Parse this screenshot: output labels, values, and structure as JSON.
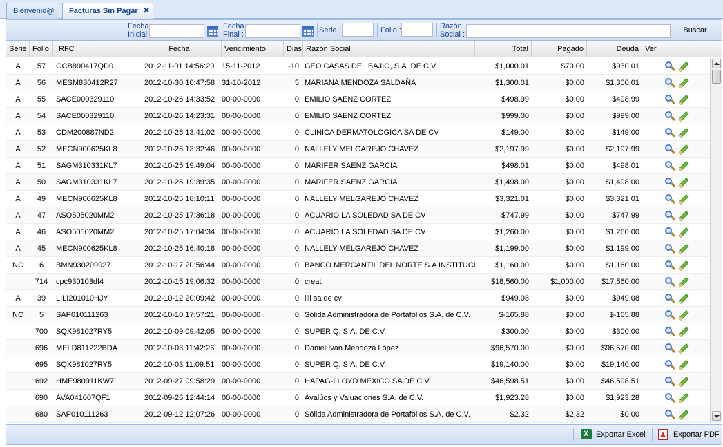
{
  "tabs": [
    {
      "label": "Bienvenid@"
    },
    {
      "label": "Facturas Sin Pagar"
    }
  ],
  "toolbar": {
    "fecha_inicial_label_1": "Fecha",
    "fecha_inicial_label_2": "Inicial :",
    "fecha_final_label_1": "Fecha",
    "fecha_final_label_2": "Final :",
    "serie_label": "Serie :",
    "folio_label": "Folio :",
    "razon_label_1": "Razón",
    "razon_label_2": "Social :",
    "fecha_inicial_value": "",
    "fecha_final_value": "",
    "serie_value": "",
    "folio_value": "",
    "razon_value": "",
    "buscar_label": "Buscar"
  },
  "columns": {
    "serie": "Serie",
    "folio": "Folio",
    "rfc": "RFC",
    "fecha": "Fecha",
    "vencimiento": "Vencimiento",
    "dias": "Dias",
    "razon": "Razón Social",
    "total": "Total",
    "pagado": "Pagado",
    "deuda": "Deuda",
    "ver": "Ver"
  },
  "rows": [
    {
      "serie": "A",
      "folio": "57",
      "rfc": "GCB890417QD0",
      "fecha": "2012-11-01 14:56:29",
      "venc": "15-11-2012",
      "dias": "-10",
      "razon": "GEO CASAS DEL BAJIO, S.A. DE C.V.",
      "total": "$1,000.01",
      "pagado": "$70.00",
      "deuda": "$930.01"
    },
    {
      "serie": "A",
      "folio": "56",
      "rfc": "MESM830412R27",
      "fecha": "2012-10-30 10:47:58",
      "venc": "31-10-2012",
      "dias": "5",
      "razon": "MARIANA MENDOZA SALDAÑA",
      "total": "$1,300.01",
      "pagado": "$0.00",
      "deuda": "$1,300.01"
    },
    {
      "serie": "A",
      "folio": "55",
      "rfc": "SACE000329110",
      "fecha": "2012-10-26 14:33:52",
      "venc": "00-00-0000",
      "dias": "0",
      "razon": "EMILIO SAENZ CORTEZ",
      "total": "$498.99",
      "pagado": "$0.00",
      "deuda": "$498.99"
    },
    {
      "serie": "A",
      "folio": "54",
      "rfc": "SACE000329110",
      "fecha": "2012-10-26 14:23:31",
      "venc": "00-00-0000",
      "dias": "0",
      "razon": "EMILIO SAENZ CORTEZ",
      "total": "$999.00",
      "pagado": "$0.00",
      "deuda": "$999.00"
    },
    {
      "serie": "A",
      "folio": "53",
      "rfc": "CDM200887ND2",
      "fecha": "2012-10-26 13:41:02",
      "venc": "00-00-0000",
      "dias": "0",
      "razon": "CLINICA DERMATOLOGICA SA DE CV",
      "total": "$149.00",
      "pagado": "$0.00",
      "deuda": "$149.00"
    },
    {
      "serie": "A",
      "folio": "52",
      "rfc": "MECN900625KL8",
      "fecha": "2012-10-26 13:32:46",
      "venc": "00-00-0000",
      "dias": "0",
      "razon": "NALLELY MELGAREJO CHAVEZ",
      "total": "$2,197.99",
      "pagado": "$0.00",
      "deuda": "$2,197.99"
    },
    {
      "serie": "A",
      "folio": "51",
      "rfc": "SAGM310331KL7",
      "fecha": "2012-10-25 19:49:04",
      "venc": "00-00-0000",
      "dias": "0",
      "razon": "MARIFER SAENZ GARCIA",
      "total": "$498.01",
      "pagado": "$0.00",
      "deuda": "$498.01"
    },
    {
      "serie": "A",
      "folio": "50",
      "rfc": "SAGM310331KL7",
      "fecha": "2012-10-25 19:39:35",
      "venc": "00-00-0000",
      "dias": "0",
      "razon": "MARIFER SAENZ GARCIA",
      "total": "$1,498.00",
      "pagado": "$0.00",
      "deuda": "$1,498.00"
    },
    {
      "serie": "A",
      "folio": "49",
      "rfc": "MECN900625KL8",
      "fecha": "2012-10-25 18:10:11",
      "venc": "00-00-0000",
      "dias": "0",
      "razon": "NALLELY MELGAREJO CHAVEZ",
      "total": "$3,321.01",
      "pagado": "$0.00",
      "deuda": "$3,321.01"
    },
    {
      "serie": "A",
      "folio": "47",
      "rfc": "ASO505020MM2",
      "fecha": "2012-10-25 17:36:18",
      "venc": "00-00-0000",
      "dias": "0",
      "razon": "ACUARIO LA SOLEDAD SA DE CV",
      "total": "$747.99",
      "pagado": "$0.00",
      "deuda": "$747.99"
    },
    {
      "serie": "A",
      "folio": "46",
      "rfc": "ASO505020MM2",
      "fecha": "2012-10-25 17:04:34",
      "venc": "00-00-0000",
      "dias": "0",
      "razon": "ACUARIO LA SOLEDAD SA DE CV",
      "total": "$1,260.00",
      "pagado": "$0.00",
      "deuda": "$1,260.00"
    },
    {
      "serie": "A",
      "folio": "45",
      "rfc": "MECN900625KL8",
      "fecha": "2012-10-25 16:40:18",
      "venc": "00-00-0000",
      "dias": "0",
      "razon": "NALLELY MELGAREJO CHAVEZ",
      "total": "$1,199.00",
      "pagado": "$0.00",
      "deuda": "$1,199.00"
    },
    {
      "serie": "NC",
      "folio": "6",
      "rfc": "BMN930209927",
      "fecha": "2012-10-17 20:56:44",
      "venc": "00-00-0000",
      "dias": "0",
      "razon": "BANCO MERCANTIL DEL NORTE S.A INSTITUCION D",
      "total": "$1,160.00",
      "pagado": "$0.00",
      "deuda": "$1,160.00"
    },
    {
      "serie": "",
      "folio": "714",
      "rfc": "cpc930103df4",
      "fecha": "2012-10-15 19:06:32",
      "venc": "00-00-0000",
      "dias": "0",
      "razon": "creat",
      "total": "$18,560.00",
      "pagado": "$1,000.00",
      "deuda": "$17,560.00"
    },
    {
      "serie": "A",
      "folio": "39",
      "rfc": "LILI201010HJY",
      "fecha": "2012-10-12 20:09:42",
      "venc": "00-00-0000",
      "dias": "0",
      "razon": "lili sa de cv",
      "total": "$949.08",
      "pagado": "$0.00",
      "deuda": "$949.08"
    },
    {
      "serie": "NC",
      "folio": "5",
      "rfc": "SAP010111263",
      "fecha": "2012-10-10 17:57:21",
      "venc": "00-00-0000",
      "dias": "0",
      "razon": "Sólida Administradora de Portafolios S.A. de C.V.",
      "total": "$-165.88",
      "pagado": "$0.00",
      "deuda": "$-165.88"
    },
    {
      "serie": "",
      "folio": "700",
      "rfc": "SQX981027RY5",
      "fecha": "2012-10-09 09:42:05",
      "venc": "00-00-0000",
      "dias": "0",
      "razon": "SUPER Q, S.A. DE C.V.",
      "total": "$300.00",
      "pagado": "$0.00",
      "deuda": "$300.00"
    },
    {
      "serie": "",
      "folio": "696",
      "rfc": "MELD811222BDA",
      "fecha": "2012-10-03 11:42:26",
      "venc": "00-00-0000",
      "dias": "0",
      "razon": "Daniel Iván Mendoza López",
      "total": "$96,570.00",
      "pagado": "$0.00",
      "deuda": "$96,570.00"
    },
    {
      "serie": "",
      "folio": "695",
      "rfc": "SQX981027RY5",
      "fecha": "2012-10-03 11:09:51",
      "venc": "00-00-0000",
      "dias": "0",
      "razon": "SUPER Q, S.A. DE C.V.",
      "total": "$19,140.00",
      "pagado": "$0.00",
      "deuda": "$19,140.00"
    },
    {
      "serie": "",
      "folio": "692",
      "rfc": "HME980911KW7",
      "fecha": "2012-09-27 09:58:29",
      "venc": "00-00-0000",
      "dias": "0",
      "razon": "HAPAG-LLOYD MEXICO SA DE C V",
      "total": "$46,598.51",
      "pagado": "$0.00",
      "deuda": "$46,598.51"
    },
    {
      "serie": "",
      "folio": "690",
      "rfc": "AVA041007QF1",
      "fecha": "2012-09-26 12:44:14",
      "venc": "00-00-0000",
      "dias": "0",
      "razon": "Avalúos y Valuaciones S.A. de C.V.",
      "total": "$1,923.28",
      "pagado": "$0.00",
      "deuda": "$1,923.28"
    },
    {
      "serie": "",
      "folio": "680",
      "rfc": "SAP010111263",
      "fecha": "2012-09-12 12:07:26",
      "venc": "00-00-0000",
      "dias": "0",
      "razon": "Sólida Administradora de Portafolios S.A. de C.V.",
      "total": "$2.32",
      "pagado": "$2.32",
      "deuda": "$0.00"
    }
  ],
  "footer": {
    "export_excel": "Exportar Excel",
    "export_pdf": "Exportar PDF"
  }
}
